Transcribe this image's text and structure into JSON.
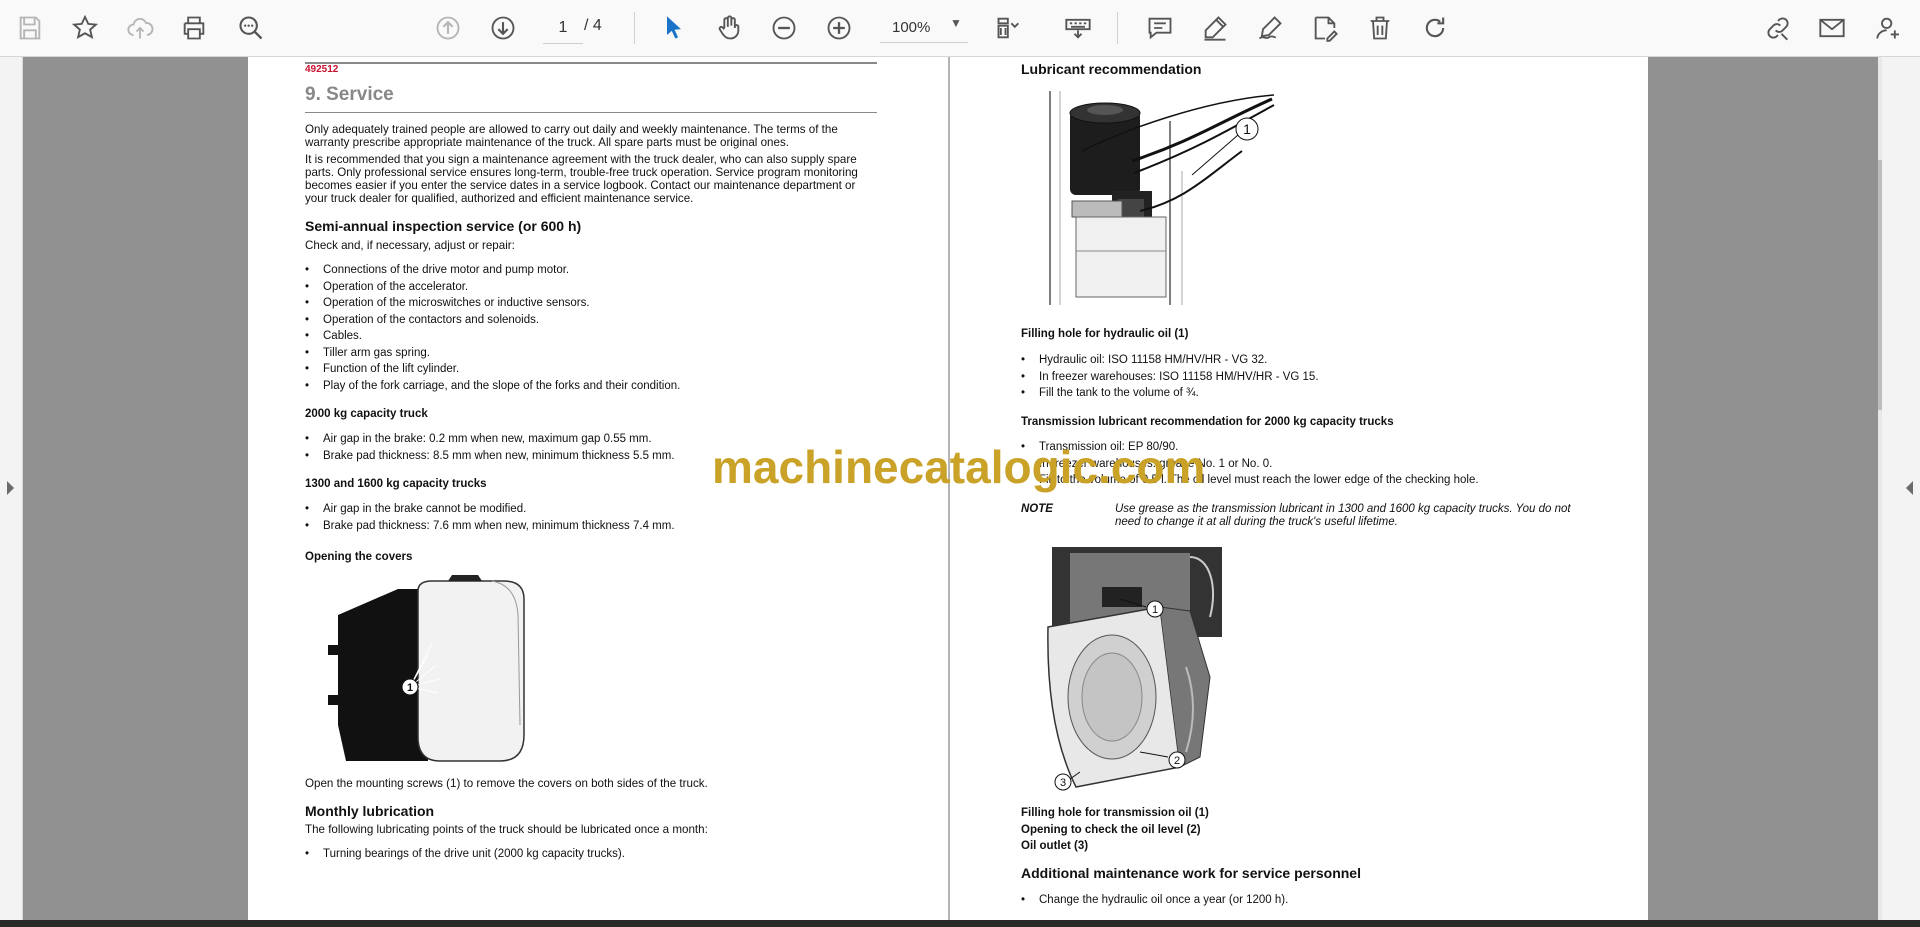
{
  "toolbar": {
    "page_current": "1",
    "page_total": "/ 4",
    "zoom": "100%",
    "icons": [
      "save-icon",
      "bookmark-star-icon",
      "cloud-upload-icon",
      "print-icon",
      "find-zoom-icon",
      "page-up-icon",
      "page-down-icon",
      "select-pointer-icon",
      "hand-pan-icon",
      "zoom-out-icon",
      "zoom-in-icon",
      "page-fit-icon",
      "keyboard-icon",
      "comment-icon",
      "highlight-pen-icon",
      "draw-pen-icon",
      "stamp-icon",
      "delete-icon",
      "rotate-icon",
      "share-link-icon",
      "email-icon",
      "add-user-icon"
    ],
    "colors": {
      "accent": "#1a73c8"
    }
  },
  "left_page": {
    "doc_number": "492512",
    "title": "9. Service",
    "intro_1": "Only adequately trained people are allowed to carry out daily and weekly maintenance. The terms of the warranty prescribe appropriate maintenance of the truck. All spare parts must be original ones.",
    "intro_2": "It is recommended that you sign a maintenance agreement with the truck dealer, who can also supply spare parts. Only professional service ensures long-term, trouble-free truck operation. Service program monitoring becomes easier if you enter the service dates in a service logbook. Contact our maintenance department or your truck dealer for qualified, authorized and efficient maintenance service.",
    "semi_title": "Semi-annual inspection service (or 600 h)",
    "semi_intro": "Check and, if necessary, adjust or repair:",
    "semi_items": [
      "Connections of the drive motor and pump motor.",
      "Operation of the accelerator.",
      "Operation of the microswitches or inductive sensors.",
      "Operation of the contactors and solenoids.",
      "Cables.",
      "Tiller arm gas spring.",
      "Function of the lift cylinder.",
      "Play of the fork carriage, and the slope of the forks and their condition."
    ],
    "truck2000_title": "2000 kg capacity truck",
    "truck2000_items": [
      "Air gap in the brake: 0.2 mm when new, maximum gap 0.55 mm.",
      "Brake pad thickness: 8.5 mm when new, minimum thickness 5.5 mm."
    ],
    "truck1300_title": "1300 and 1600 kg capacity trucks",
    "truck1300_items": [
      "Air gap in the brake cannot be modified.",
      "Brake pad thickness: 7.6 mm when new, minimum thickness 7.4 mm."
    ],
    "covers_title": "Opening the covers",
    "covers_callout": "1",
    "covers_caption": "Open the mounting screws (1) to remove the covers on both sides of the truck.",
    "monthly_title": "Monthly lubrication",
    "monthly_intro": "The following lubricating points of the truck should be lubricated once a month:",
    "monthly_items": [
      "Turning bearings of the drive unit (2000 kg capacity trucks)."
    ]
  },
  "right_page": {
    "lub_title": "Lubricant recommendation",
    "fig1_callout": "1",
    "filling_hyd_title": "Filling hole for hydraulic oil (1)",
    "hyd_items": [
      "Hydraulic oil: ISO 11158 HM/HV/HR - VG 32.",
      "In freezer warehouses: ISO 11158 HM/HV/HR - VG 15.",
      "Fill the tank to the volume of ¾."
    ],
    "trans_title": "Transmission lubricant recommendation for 2000 kg capacity trucks",
    "trans_items": [
      "Transmission oil: EP 80/90.",
      "In freezer warehouses: grease No. 1 or No. 0.",
      "Fill to the volume of 0.5 l. The oil level must reach the lower edge of the checking hole."
    ],
    "note_label": "NOTE",
    "note_text": "Use grease as the transmission lubricant in 1300 and 1600 kg capacity trucks. You do not need to change it at all during the truck's useful lifetime.",
    "fig2_callouts": [
      "1",
      "2",
      "3"
    ],
    "fig2_caption_1": "Filling hole for transmission oil (1)",
    "fig2_caption_2": "Opening to check the oil level (2)",
    "fig2_caption_3": "Oil outlet (3)",
    "addl_title": "Additional maintenance work for service personnel",
    "addl_items": [
      "Change the hydraulic oil once a year (or 1200 h)."
    ]
  },
  "watermark": "machinecatalogic.com"
}
